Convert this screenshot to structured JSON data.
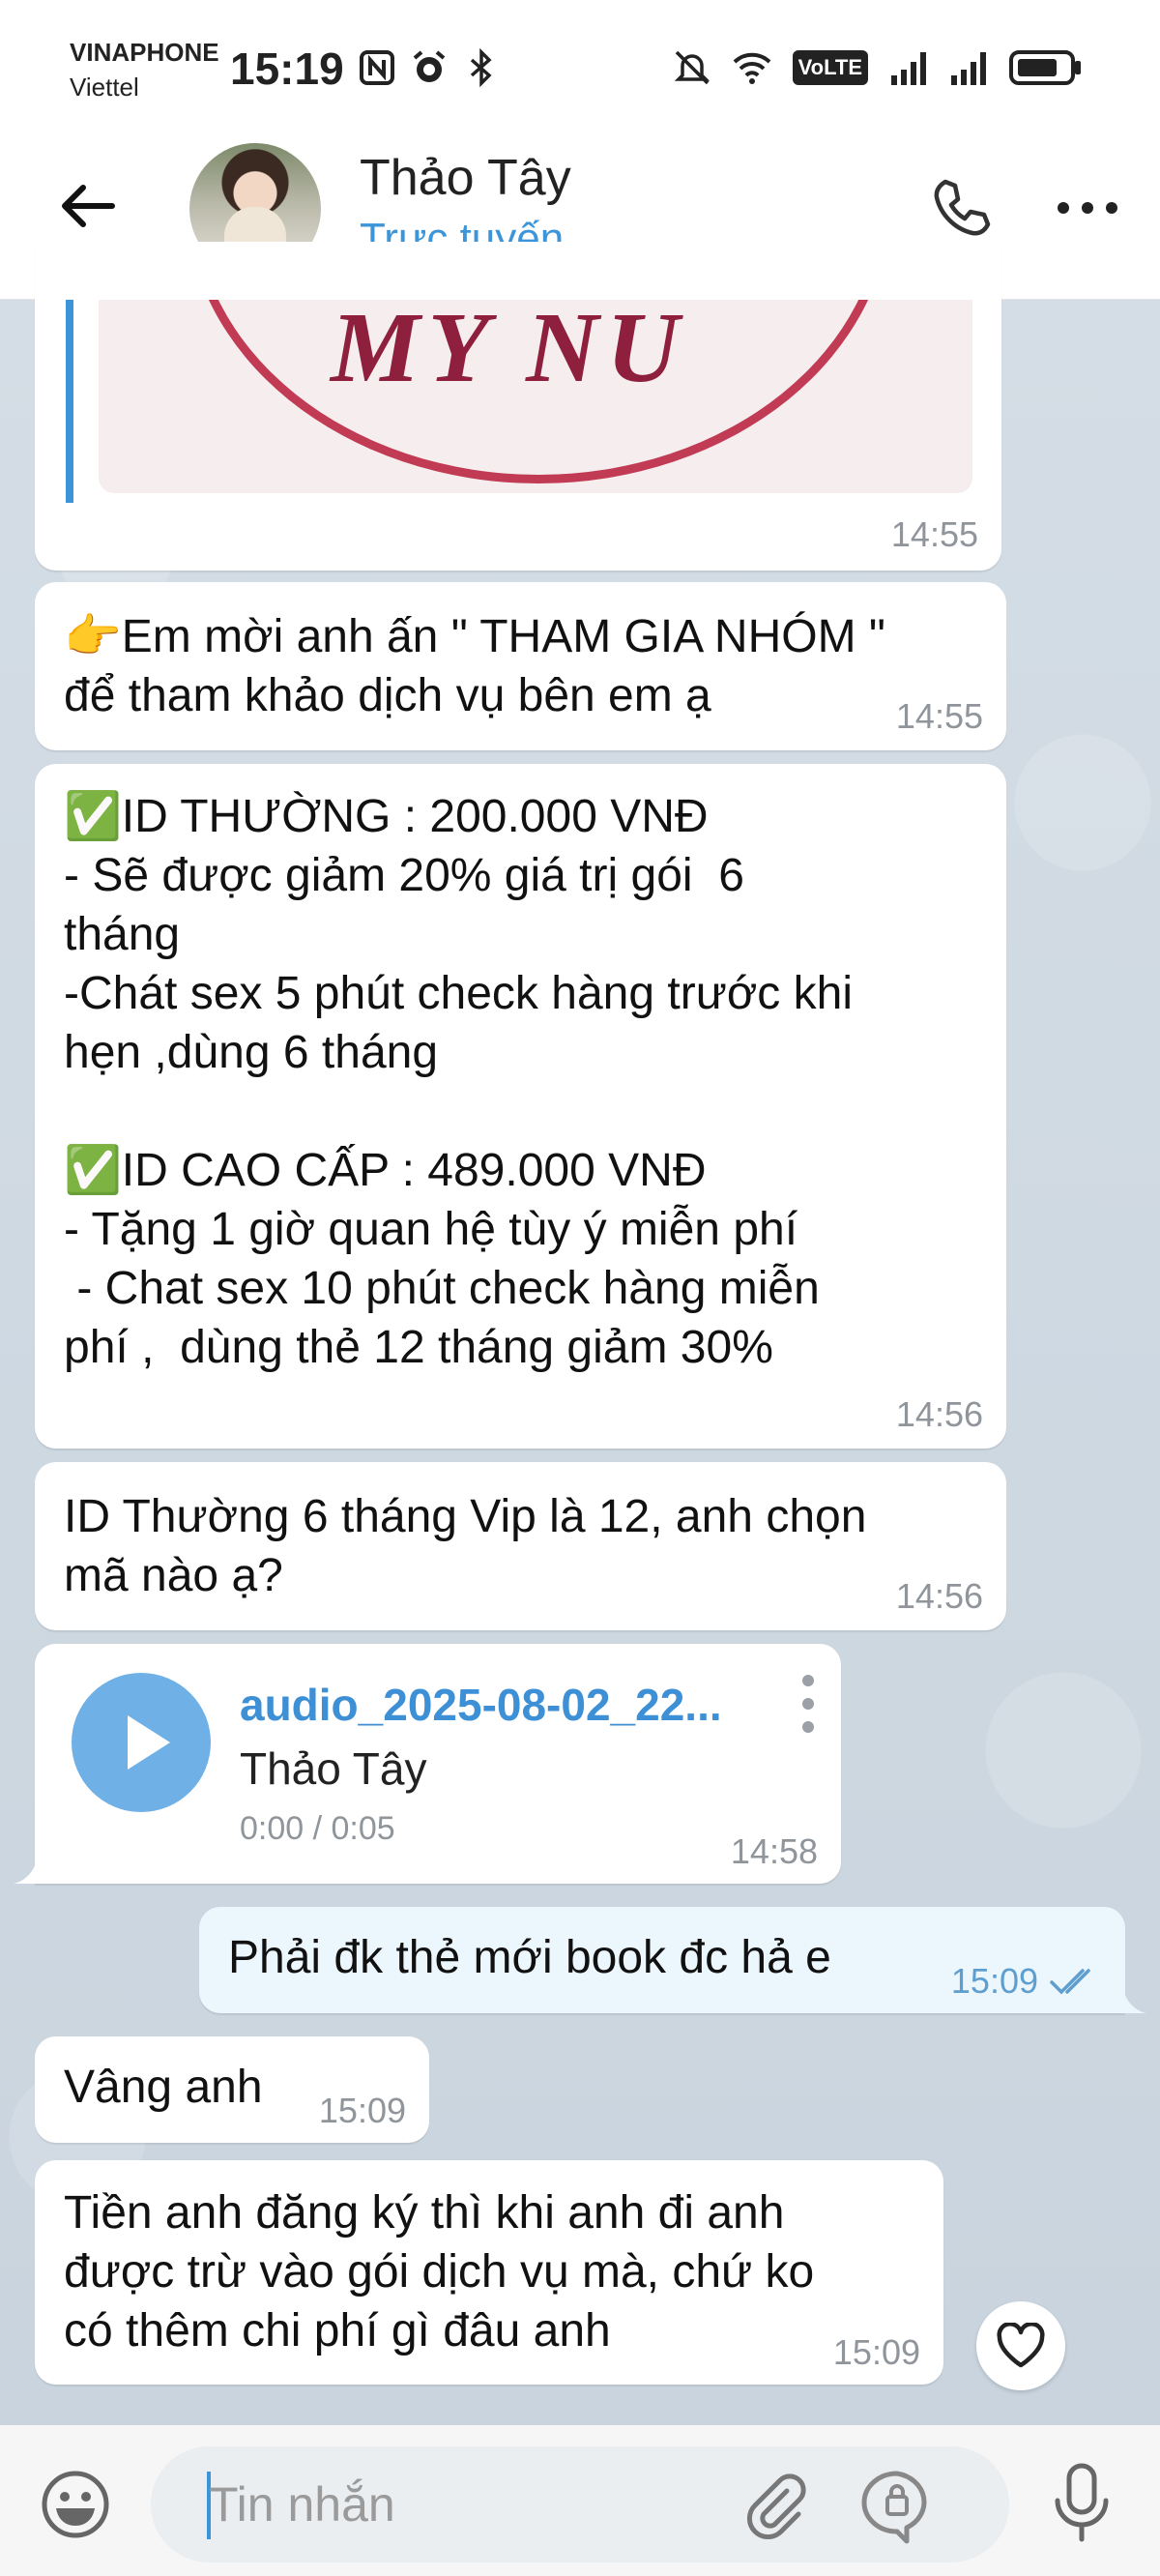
{
  "status_bar": {
    "carrier_1": "VINAPHONE",
    "carrier_2": "Viettel",
    "time": "15:19",
    "network_badge": "VoLTE",
    "icons": [
      "nfc-icon",
      "alarm-icon",
      "bluetooth-icon",
      "mute-icon",
      "wifi-icon",
      "signal-icon",
      "signal-icon",
      "battery-icon"
    ]
  },
  "header": {
    "contact_name": "Thảo Tây",
    "contact_status": "Trực tuyến",
    "icons": [
      "back-arrow-icon",
      "phone-icon",
      "more-icon"
    ]
  },
  "messages": [
    {
      "type": "image",
      "brand_text": "MY NU",
      "time": "14:55"
    },
    {
      "type": "text",
      "text": "👉Em mời anh ấn \" THAM GIA NHÓM \"\nđể tham khảo dịch vụ bên em ạ",
      "time": "14:55"
    },
    {
      "type": "text",
      "text": "✅ID THƯỜNG : 200.000 VNĐ\n- Sẽ được giảm 20% giá trị gói  6\ntháng\n-Chát sex 5 phút check hàng trước khi\nhẹn ,dùng 6 tháng\n\n✅ID CAO CẤP : 489.000 VNĐ\n- Tặng 1 giờ quan hệ tùy ý miễn phí\n - Chat sex 10 phút check hàng miễn\nphí ,  dùng thẻ 12 tháng giảm 30%",
      "time": "14:56"
    },
    {
      "type": "text",
      "text": "ID Thường 6 tháng Vip là 12, anh chọn\nmã nào ạ?",
      "time": "14:56"
    },
    {
      "type": "audio",
      "title": "audio_2025-08-02_22...",
      "sender": "Thảo Tây",
      "duration": "0:00 / 0:05",
      "time": "14:58"
    },
    {
      "type": "text",
      "direction": "outgoing",
      "text": "Phải đk thẻ mới book đc hả e",
      "time": "15:09",
      "read": true
    },
    {
      "type": "text",
      "text": "Vâng anh",
      "time": "15:09"
    },
    {
      "type": "text",
      "text": "Tiền anh đăng ký thì khi anh đi anh\nđược trừ vào gói dịch vụ mà, chứ ko\ncó thêm chi phí gì đâu anh",
      "time": "15:09"
    }
  ],
  "input_bar": {
    "placeholder": "Tin nhắn",
    "icons": [
      "emoji-icon",
      "attach-icon",
      "sticker-icon",
      "mic-icon"
    ]
  },
  "colors": {
    "accent": "#3d95d9",
    "incoming_bubble": "#ffffff",
    "outgoing_bubble": "#ecf6fd",
    "chat_background": "#cfd9e2"
  }
}
